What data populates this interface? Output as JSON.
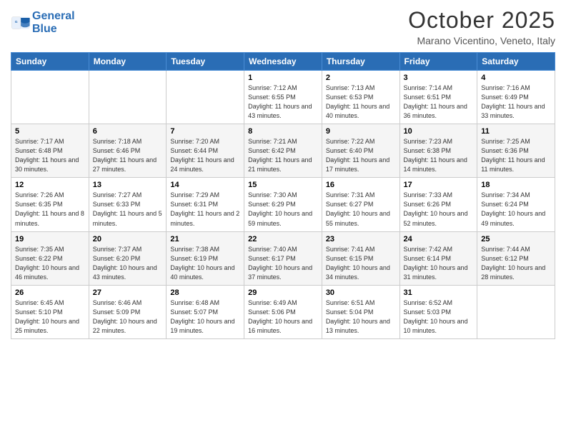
{
  "header": {
    "logo_line1": "General",
    "logo_line2": "Blue",
    "month_title": "October 2025",
    "subtitle": "Marano Vicentino, Veneto, Italy"
  },
  "days_of_week": [
    "Sunday",
    "Monday",
    "Tuesday",
    "Wednesday",
    "Thursday",
    "Friday",
    "Saturday"
  ],
  "weeks": [
    [
      {
        "day": "",
        "info": ""
      },
      {
        "day": "",
        "info": ""
      },
      {
        "day": "",
        "info": ""
      },
      {
        "day": "1",
        "info": "Sunrise: 7:12 AM\nSunset: 6:55 PM\nDaylight: 11 hours and 43 minutes."
      },
      {
        "day": "2",
        "info": "Sunrise: 7:13 AM\nSunset: 6:53 PM\nDaylight: 11 hours and 40 minutes."
      },
      {
        "day": "3",
        "info": "Sunrise: 7:14 AM\nSunset: 6:51 PM\nDaylight: 11 hours and 36 minutes."
      },
      {
        "day": "4",
        "info": "Sunrise: 7:16 AM\nSunset: 6:49 PM\nDaylight: 11 hours and 33 minutes."
      }
    ],
    [
      {
        "day": "5",
        "info": "Sunrise: 7:17 AM\nSunset: 6:48 PM\nDaylight: 11 hours and 30 minutes."
      },
      {
        "day": "6",
        "info": "Sunrise: 7:18 AM\nSunset: 6:46 PM\nDaylight: 11 hours and 27 minutes."
      },
      {
        "day": "7",
        "info": "Sunrise: 7:20 AM\nSunset: 6:44 PM\nDaylight: 11 hours and 24 minutes."
      },
      {
        "day": "8",
        "info": "Sunrise: 7:21 AM\nSunset: 6:42 PM\nDaylight: 11 hours and 21 minutes."
      },
      {
        "day": "9",
        "info": "Sunrise: 7:22 AM\nSunset: 6:40 PM\nDaylight: 11 hours and 17 minutes."
      },
      {
        "day": "10",
        "info": "Sunrise: 7:23 AM\nSunset: 6:38 PM\nDaylight: 11 hours and 14 minutes."
      },
      {
        "day": "11",
        "info": "Sunrise: 7:25 AM\nSunset: 6:36 PM\nDaylight: 11 hours and 11 minutes."
      }
    ],
    [
      {
        "day": "12",
        "info": "Sunrise: 7:26 AM\nSunset: 6:35 PM\nDaylight: 11 hours and 8 minutes."
      },
      {
        "day": "13",
        "info": "Sunrise: 7:27 AM\nSunset: 6:33 PM\nDaylight: 11 hours and 5 minutes."
      },
      {
        "day": "14",
        "info": "Sunrise: 7:29 AM\nSunset: 6:31 PM\nDaylight: 11 hours and 2 minutes."
      },
      {
        "day": "15",
        "info": "Sunrise: 7:30 AM\nSunset: 6:29 PM\nDaylight: 10 hours and 59 minutes."
      },
      {
        "day": "16",
        "info": "Sunrise: 7:31 AM\nSunset: 6:27 PM\nDaylight: 10 hours and 55 minutes."
      },
      {
        "day": "17",
        "info": "Sunrise: 7:33 AM\nSunset: 6:26 PM\nDaylight: 10 hours and 52 minutes."
      },
      {
        "day": "18",
        "info": "Sunrise: 7:34 AM\nSunset: 6:24 PM\nDaylight: 10 hours and 49 minutes."
      }
    ],
    [
      {
        "day": "19",
        "info": "Sunrise: 7:35 AM\nSunset: 6:22 PM\nDaylight: 10 hours and 46 minutes."
      },
      {
        "day": "20",
        "info": "Sunrise: 7:37 AM\nSunset: 6:20 PM\nDaylight: 10 hours and 43 minutes."
      },
      {
        "day": "21",
        "info": "Sunrise: 7:38 AM\nSunset: 6:19 PM\nDaylight: 10 hours and 40 minutes."
      },
      {
        "day": "22",
        "info": "Sunrise: 7:40 AM\nSunset: 6:17 PM\nDaylight: 10 hours and 37 minutes."
      },
      {
        "day": "23",
        "info": "Sunrise: 7:41 AM\nSunset: 6:15 PM\nDaylight: 10 hours and 34 minutes."
      },
      {
        "day": "24",
        "info": "Sunrise: 7:42 AM\nSunset: 6:14 PM\nDaylight: 10 hours and 31 minutes."
      },
      {
        "day": "25",
        "info": "Sunrise: 7:44 AM\nSunset: 6:12 PM\nDaylight: 10 hours and 28 minutes."
      }
    ],
    [
      {
        "day": "26",
        "info": "Sunrise: 6:45 AM\nSunset: 5:10 PM\nDaylight: 10 hours and 25 minutes."
      },
      {
        "day": "27",
        "info": "Sunrise: 6:46 AM\nSunset: 5:09 PM\nDaylight: 10 hours and 22 minutes."
      },
      {
        "day": "28",
        "info": "Sunrise: 6:48 AM\nSunset: 5:07 PM\nDaylight: 10 hours and 19 minutes."
      },
      {
        "day": "29",
        "info": "Sunrise: 6:49 AM\nSunset: 5:06 PM\nDaylight: 10 hours and 16 minutes."
      },
      {
        "day": "30",
        "info": "Sunrise: 6:51 AM\nSunset: 5:04 PM\nDaylight: 10 hours and 13 minutes."
      },
      {
        "day": "31",
        "info": "Sunrise: 6:52 AM\nSunset: 5:03 PM\nDaylight: 10 hours and 10 minutes."
      },
      {
        "day": "",
        "info": ""
      }
    ]
  ]
}
